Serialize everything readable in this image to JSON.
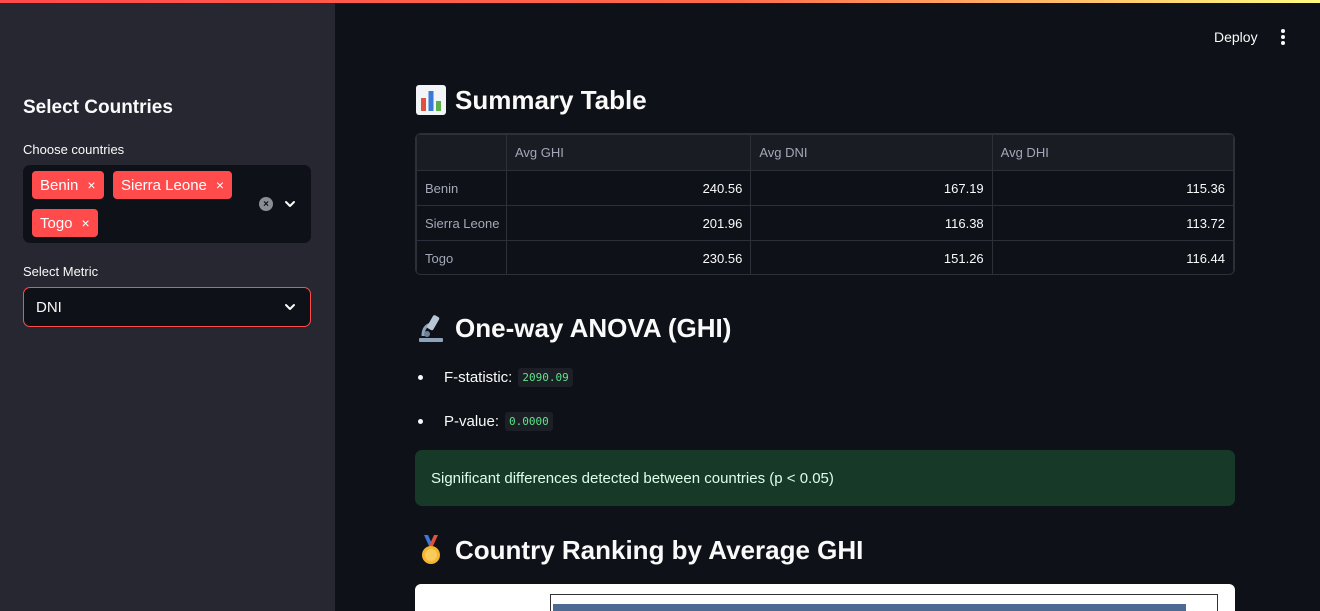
{
  "sidebar": {
    "title": "Select Countries",
    "countries_label": "Choose countries",
    "selected_countries": [
      "Benin",
      "Sierra Leone",
      "Togo"
    ],
    "chip_remove_glyph": "×",
    "metric_label": "Select Metric",
    "metric_value": "DNI"
  },
  "header": {
    "deploy_label": "Deploy"
  },
  "summary": {
    "title": "Summary Table",
    "columns": [
      "",
      "Avg GHI",
      "Avg DNI",
      "Avg DHI"
    ],
    "rows": [
      {
        "country": "Benin",
        "values": [
          "240.56",
          "167.19",
          "115.36"
        ]
      },
      {
        "country": "Sierra Leone",
        "values": [
          "201.96",
          "116.38",
          "113.72"
        ]
      },
      {
        "country": "Togo",
        "values": [
          "230.56",
          "151.26",
          "116.44"
        ]
      }
    ]
  },
  "anova": {
    "title": "One-way ANOVA (GHI)",
    "f_label": "F-statistic:",
    "f_value": "2090.09",
    "p_label": "P-value:",
    "p_value": "0.0000",
    "result_message": "Significant differences detected between countries (p < 0.05)"
  },
  "ranking": {
    "title": "Country Ranking by Average GHI"
  },
  "colors": {
    "accent": "#ff4b4b",
    "background": "#0e1117",
    "sidebar": "#262730",
    "success_bg": "#173928",
    "code_green": "#5ce488",
    "chart_bar": "#4c6a92"
  },
  "icons": {
    "summary_heading": "bar-chart-emoji-icon",
    "anova_heading": "microscope-emoji-icon",
    "ranking_heading": "medal-emoji-icon",
    "menu": "vertical-dots-icon",
    "clear": "clear-circle-icon",
    "dropdown": "chevron-down-icon"
  }
}
